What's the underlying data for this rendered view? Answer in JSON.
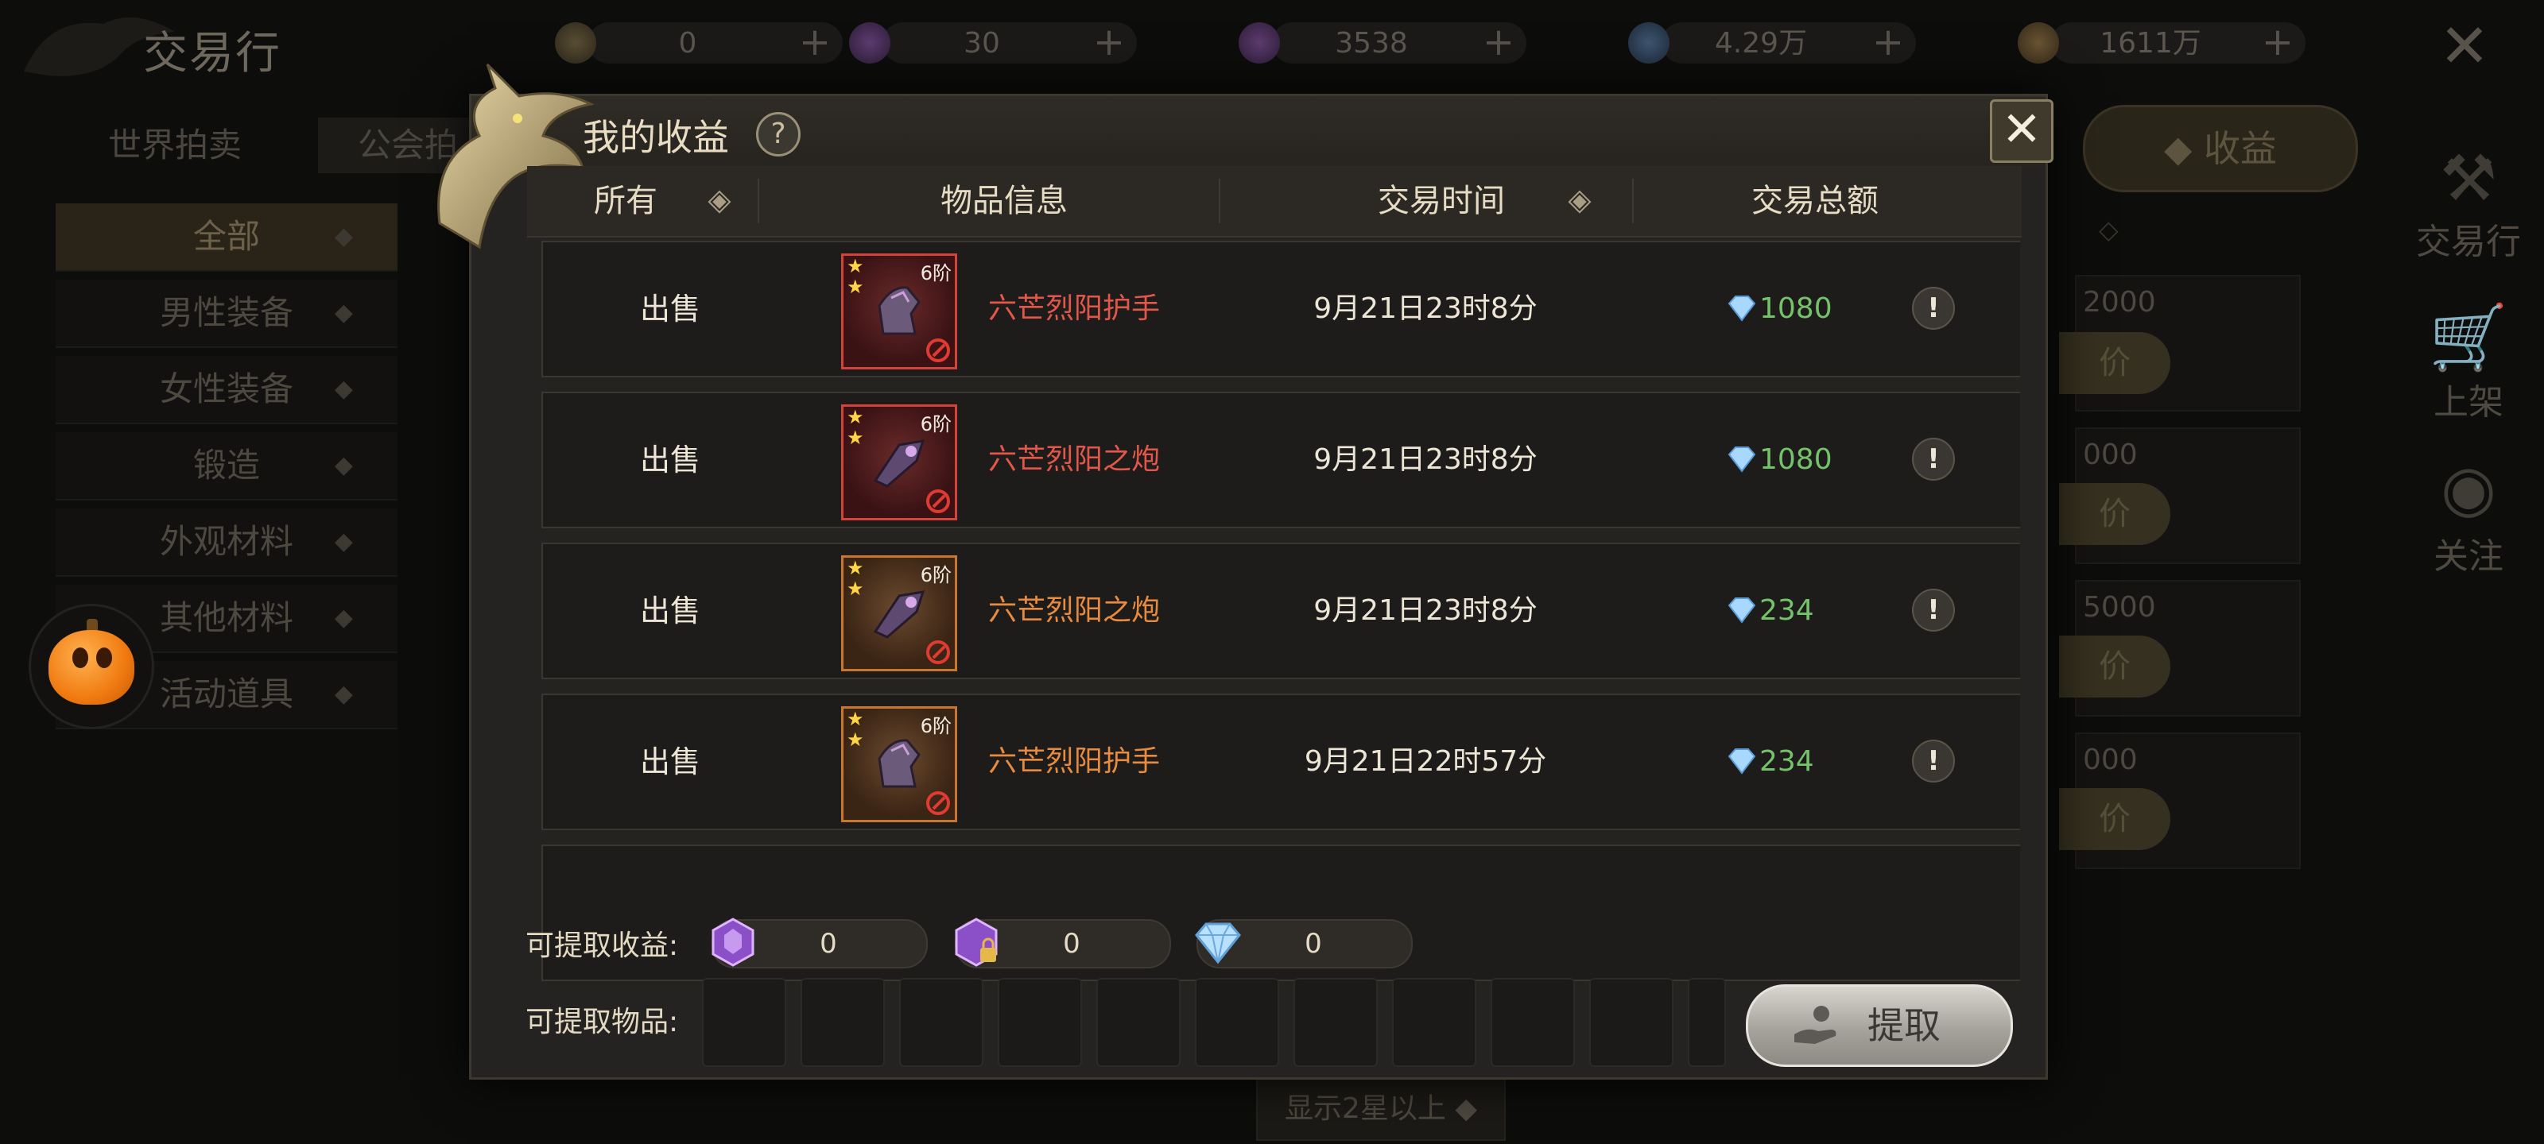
{
  "background": {
    "title": "交易行",
    "currencies": [
      {
        "icon": "coin-icon",
        "value": "0"
      },
      {
        "icon": "purple-crystal-icon",
        "value": "30"
      },
      {
        "icon": "bound-crystal-icon",
        "value": "3538"
      },
      {
        "icon": "diamond-icon",
        "value": "4.29万"
      },
      {
        "icon": "gold-icon",
        "value": "1611万"
      }
    ],
    "tabs": {
      "world": "世界拍卖",
      "guild": "公会拍"
    },
    "categories": [
      "全部",
      "男性装备",
      "女性装备",
      "锻造",
      "外观材料",
      "其他材料",
      "活动道具"
    ],
    "income_button": "收益",
    "side": {
      "trade": "交易行",
      "shelf": "上架",
      "follow": "关注"
    },
    "prices": [
      "2000",
      "000",
      "5000",
      "000"
    ],
    "buy_label": "价",
    "filter": "显示2星以上"
  },
  "modal": {
    "title": "我的收益",
    "headers": {
      "type": "所有",
      "item": "物品信息",
      "time": "交易时间",
      "total": "交易总额"
    },
    "rows": [
      {
        "type": "出售",
        "tier": "6阶",
        "stars": 2,
        "quality": "red",
        "name": "六芒烈阳护手",
        "name_color": "#e2574a",
        "time": "9月21日23时8分",
        "amount": "1080"
      },
      {
        "type": "出售",
        "tier": "6阶",
        "stars": 2,
        "quality": "red",
        "name": "六芒烈阳之炮",
        "name_color": "#e2574a",
        "time": "9月21日23时8分",
        "amount": "1080"
      },
      {
        "type": "出售",
        "tier": "6阶",
        "stars": 2,
        "quality": "orange",
        "name": "六芒烈阳之炮",
        "name_color": "#e88b3e",
        "time": "9月21日23时8分",
        "amount": "234"
      },
      {
        "type": "出售",
        "tier": "6阶",
        "stars": 2,
        "quality": "orange",
        "name": "六芒烈阳护手",
        "name_color": "#e88b3e",
        "time": "9月21日22时57分",
        "amount": "234"
      }
    ],
    "withdrawable_income_label": "可提取收益:",
    "income": [
      {
        "icon": "purple-crystal-icon",
        "value": "0"
      },
      {
        "icon": "bound-crystal-icon",
        "value": "0"
      },
      {
        "icon": "diamond-icon",
        "value": "0"
      }
    ],
    "withdrawable_items_label": "可提取物品:",
    "claim_button": "提取"
  }
}
